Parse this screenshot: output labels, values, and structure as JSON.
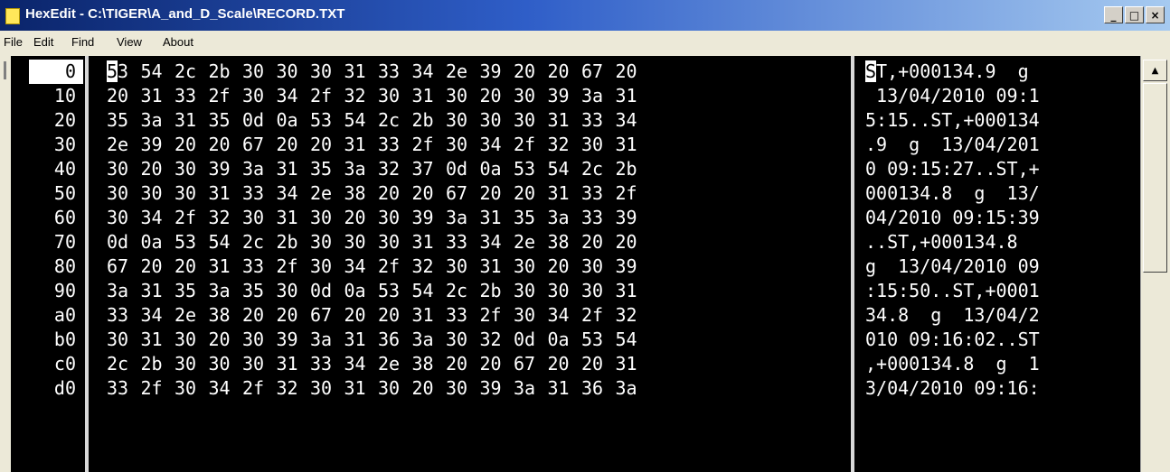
{
  "window": {
    "title": "HexEdit - C:\\TIGER\\A_and_D_Scale\\RECORD.TXT",
    "minimize_label": "_",
    "maximize_label": "□",
    "close_label": "×"
  },
  "menu": {
    "items": [
      {
        "label": "File"
      },
      {
        "label": "Edit"
      },
      {
        "label": "Find"
      },
      {
        "label": "View"
      },
      {
        "label": "About"
      }
    ]
  },
  "scrollbar": {
    "up_arrow": "▲"
  },
  "hex_view": {
    "rows": [
      {
        "offset": "0",
        "hex": [
          "53",
          "54",
          "2c",
          "2b",
          "30",
          "30",
          "30",
          "31",
          "33",
          "34",
          "2e",
          "39",
          "20",
          "20",
          "67",
          "20"
        ],
        "ascii": "ST,+000134.9  g "
      },
      {
        "offset": "10",
        "hex": [
          "20",
          "31",
          "33",
          "2f",
          "30",
          "34",
          "2f",
          "32",
          "30",
          "31",
          "30",
          "20",
          "30",
          "39",
          "3a",
          "31"
        ],
        "ascii": " 13/04/2010 09:1"
      },
      {
        "offset": "20",
        "hex": [
          "35",
          "3a",
          "31",
          "35",
          "0d",
          "0a",
          "53",
          "54",
          "2c",
          "2b",
          "30",
          "30",
          "30",
          "31",
          "33",
          "34"
        ],
        "ascii": "5:15..ST,+000134"
      },
      {
        "offset": "30",
        "hex": [
          "2e",
          "39",
          "20",
          "20",
          "67",
          "20",
          "20",
          "31",
          "33",
          "2f",
          "30",
          "34",
          "2f",
          "32",
          "30",
          "31"
        ],
        "ascii": ".9  g  13/04/201"
      },
      {
        "offset": "40",
        "hex": [
          "30",
          "20",
          "30",
          "39",
          "3a",
          "31",
          "35",
          "3a",
          "32",
          "37",
          "0d",
          "0a",
          "53",
          "54",
          "2c",
          "2b"
        ],
        "ascii": "0 09:15:27..ST,+"
      },
      {
        "offset": "50",
        "hex": [
          "30",
          "30",
          "30",
          "31",
          "33",
          "34",
          "2e",
          "38",
          "20",
          "20",
          "67",
          "20",
          "20",
          "31",
          "33",
          "2f"
        ],
        "ascii": "000134.8  g  13/"
      },
      {
        "offset": "60",
        "hex": [
          "30",
          "34",
          "2f",
          "32",
          "30",
          "31",
          "30",
          "20",
          "30",
          "39",
          "3a",
          "31",
          "35",
          "3a",
          "33",
          "39"
        ],
        "ascii": "04/2010 09:15:39"
      },
      {
        "offset": "70",
        "hex": [
          "0d",
          "0a",
          "53",
          "54",
          "2c",
          "2b",
          "30",
          "30",
          "30",
          "31",
          "33",
          "34",
          "2e",
          "38",
          "20",
          "20"
        ],
        "ascii": "..ST,+000134.8  "
      },
      {
        "offset": "80",
        "hex": [
          "67",
          "20",
          "20",
          "31",
          "33",
          "2f",
          "30",
          "34",
          "2f",
          "32",
          "30",
          "31",
          "30",
          "20",
          "30",
          "39"
        ],
        "ascii": "g  13/04/2010 09"
      },
      {
        "offset": "90",
        "hex": [
          "3a",
          "31",
          "35",
          "3a",
          "35",
          "30",
          "0d",
          "0a",
          "53",
          "54",
          "2c",
          "2b",
          "30",
          "30",
          "30",
          "31"
        ],
        "ascii": ":15:50..ST,+0001"
      },
      {
        "offset": "a0",
        "hex": [
          "33",
          "34",
          "2e",
          "38",
          "20",
          "20",
          "67",
          "20",
          "20",
          "31",
          "33",
          "2f",
          "30",
          "34",
          "2f",
          "32"
        ],
        "ascii": "34.8  g  13/04/2"
      },
      {
        "offset": "b0",
        "hex": [
          "30",
          "31",
          "30",
          "20",
          "30",
          "39",
          "3a",
          "31",
          "36",
          "3a",
          "30",
          "32",
          "0d",
          "0a",
          "53",
          "54"
        ],
        "ascii": "010 09:16:02..ST"
      },
      {
        "offset": "c0",
        "hex": [
          "2c",
          "2b",
          "30",
          "30",
          "30",
          "31",
          "33",
          "34",
          "2e",
          "38",
          "20",
          "20",
          "67",
          "20",
          "20",
          "31"
        ],
        "ascii": ",+000134.8  g  1"
      },
      {
        "offset": "d0",
        "hex": [
          "33",
          "2f",
          "30",
          "34",
          "2f",
          "32",
          "30",
          "31",
          "30",
          "20",
          "30",
          "39",
          "3a",
          "31",
          "36",
          "3a"
        ],
        "ascii": "3/04/2010 09:16:"
      }
    ]
  }
}
